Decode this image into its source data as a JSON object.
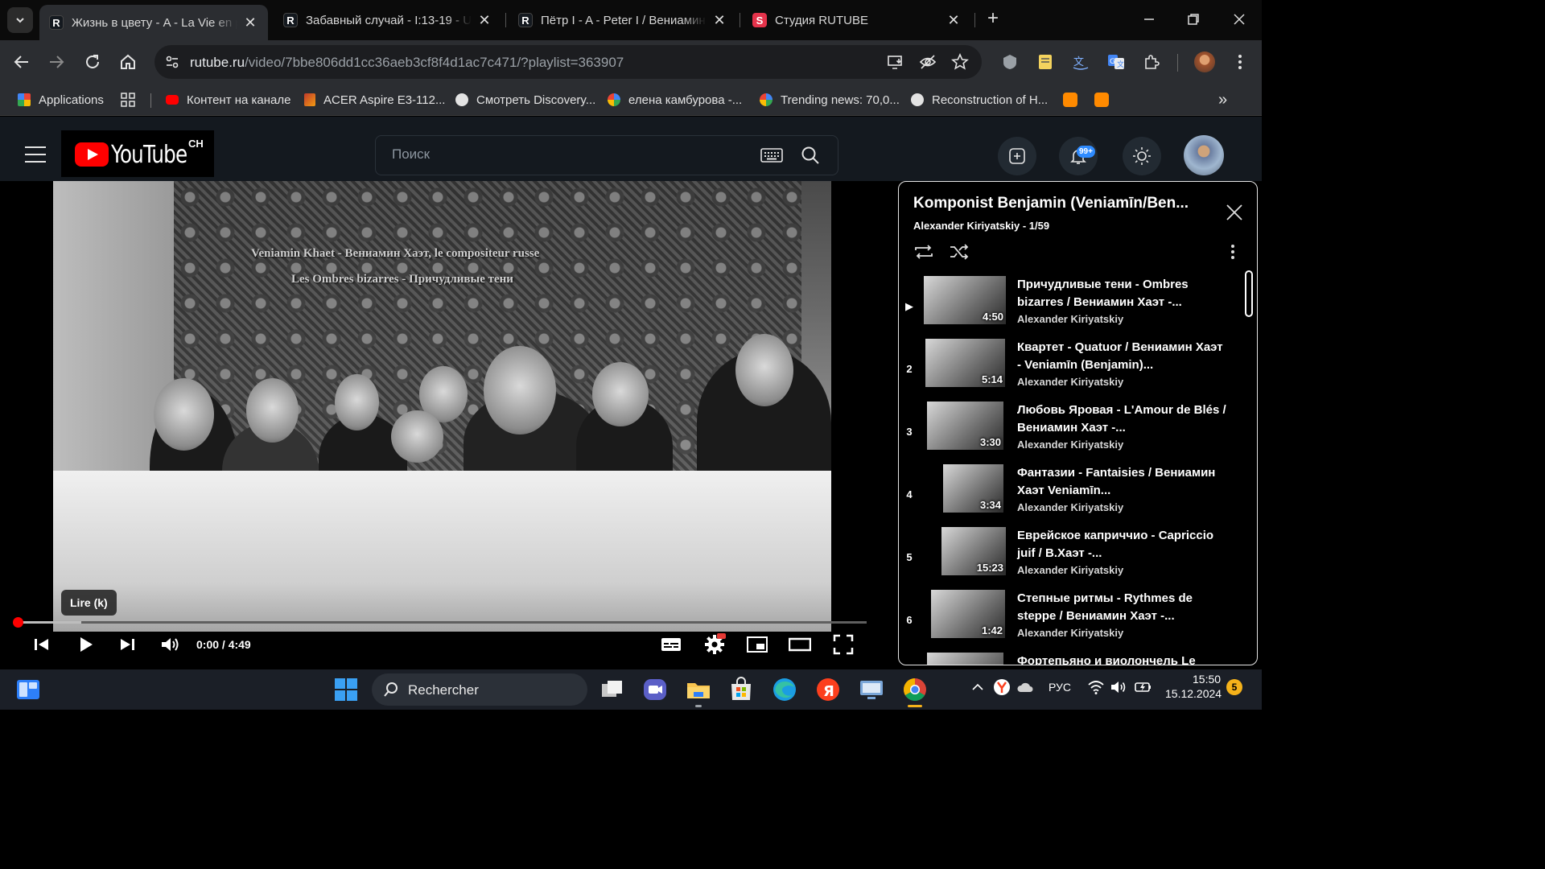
{
  "browser": {
    "tabs": [
      {
        "title": "Жизнь в цвету - A - La Vie en p",
        "active": true,
        "favicon": "rutube-icon"
      },
      {
        "title": "Забавный случай - I:13-19 - Ur",
        "active": false,
        "favicon": "rutube-icon"
      },
      {
        "title": "Пётр I - A - Peter I / Вениамин",
        "active": false,
        "favicon": "rutube-icon"
      },
      {
        "title": "Студия RUTUBE",
        "active": false,
        "favicon": "rutube-studio-icon"
      }
    ],
    "url_host": "rutube.ru",
    "url_path": "/video/7bbe806dd1cc36aeb3cf8f4d1ac7c471/?playlist=363907",
    "bookmarks": [
      {
        "label": "Applications"
      },
      {
        "label": "Контент на канале"
      },
      {
        "label": "ACER Aspire E3-112..."
      },
      {
        "label": "Смотреть Discovery..."
      },
      {
        "label": "елена камбурова -..."
      },
      {
        "label": "Trending news: 70,0..."
      },
      {
        "label": "Reconstruction of H..."
      }
    ]
  },
  "site": {
    "logo_text": "YouTube",
    "logo_suffix": "CH",
    "search_placeholder": "Поиск",
    "notifications_badge": "99+"
  },
  "player": {
    "caption_line1": "Veniamin Khaet - Вениамин Хаэт, le compositeur russe",
    "caption_line2": "Les Ombres bizarres - Причудливые тени",
    "tooltip": "Lire (k)",
    "time": "0:00 / 4:49",
    "progress_fraction": 0,
    "buffer_fraction": 0.075
  },
  "playlist": {
    "title": "Komponist Benjamin (Veniamīn/Ben...",
    "subtitle": "Alexander Kiriyatskiy - 1/59",
    "items": [
      {
        "index": "▶",
        "title": "Причудливые тени - Ombres bizarres / Вениамин Хаэт -...",
        "author": "Alexander Kiriyatskiy",
        "duration": "4:50"
      },
      {
        "index": "2",
        "title": "Квартет - Quatuor / Вениамин Хаэт - Veniamīn (Benjamin)...",
        "author": "Alexander Kiriyatskiy",
        "duration": "5:14"
      },
      {
        "index": "3",
        "title": "Любовь Яровая - L'Amour de Blés / Вениамин Хаэт -...",
        "author": "Alexander Kiriyatskiy",
        "duration": "3:30"
      },
      {
        "index": "4",
        "title": "Фантазии - Fantaisies / Вениамин Хаэт Veniamīn...",
        "author": "Alexander Kiriyatskiy",
        "duration": "3:34"
      },
      {
        "index": "5",
        "title": "Еврейское каприччио - Capriccio juif / В.Хаэт -...",
        "author": "Alexander Kiriyatskiy",
        "duration": "15:23"
      },
      {
        "index": "6",
        "title": "Степные ритмы - Rythmes de steppe / Вениамин Хаэт -...",
        "author": "Alexander Kiriyatskiy",
        "duration": "1:42"
      },
      {
        "index": "",
        "title": "Фортепьяно и виолончель Le",
        "author": "",
        "duration": ""
      }
    ]
  },
  "taskbar": {
    "search_label": "Rechercher",
    "lang": "РУС",
    "time": "15:50",
    "date": "15.12.2024",
    "notification_count": "5"
  },
  "colors": {
    "accent_red": "#ff0000",
    "header_bg": "#14191f",
    "chrome_bg": "#2b2d31"
  }
}
